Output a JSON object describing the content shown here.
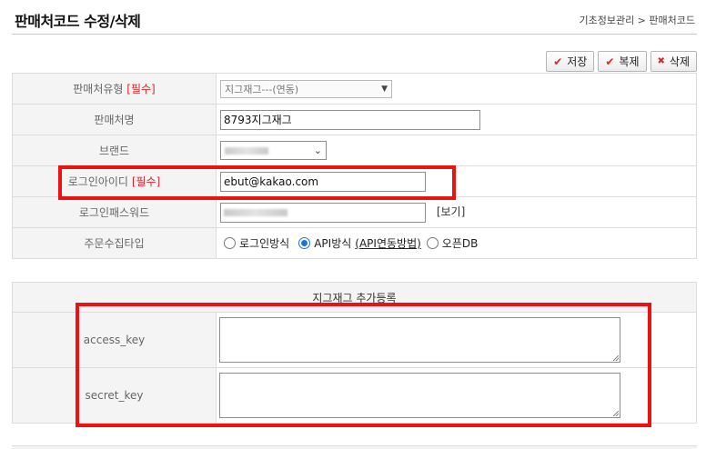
{
  "header": {
    "title": "판매처코드 수정/삭제",
    "breadcrumb": "기초정보관리 > 판매처코드"
  },
  "toolbar": {
    "save_label": "저장",
    "copy_label": "복제",
    "delete_label": "삭제"
  },
  "form": {
    "seller_type": {
      "label": "판매처유형",
      "required_mark": "[필수]",
      "value": "지그재그---(연동)"
    },
    "seller_name": {
      "label": "판매처명",
      "value": "8793지그재그"
    },
    "brand": {
      "label": "브랜드"
    },
    "login_id": {
      "label": "로그인아이디",
      "required_mark": "[필수]",
      "value": "ebut@kakao.com"
    },
    "login_password": {
      "label": "로그인패스워드",
      "view_link": "[보기]"
    },
    "order_collect_type": {
      "label": "주문수집타입",
      "options": [
        {
          "label": "로그인방식",
          "selected": false
        },
        {
          "label": "API방식",
          "selected": true
        },
        {
          "label": "오픈DB",
          "selected": false
        }
      ],
      "api_link": "(API연동방법)"
    }
  },
  "zigzag": {
    "section_title": "지그재그 추가등록",
    "access_key_label": "access_key",
    "secret_key_label": "secret_key",
    "access_key_value": "",
    "secret_key_value": ""
  },
  "colors": {
    "highlight": "#ee1111",
    "required": "#d9262c",
    "radio_accent": "#1a73e8"
  }
}
